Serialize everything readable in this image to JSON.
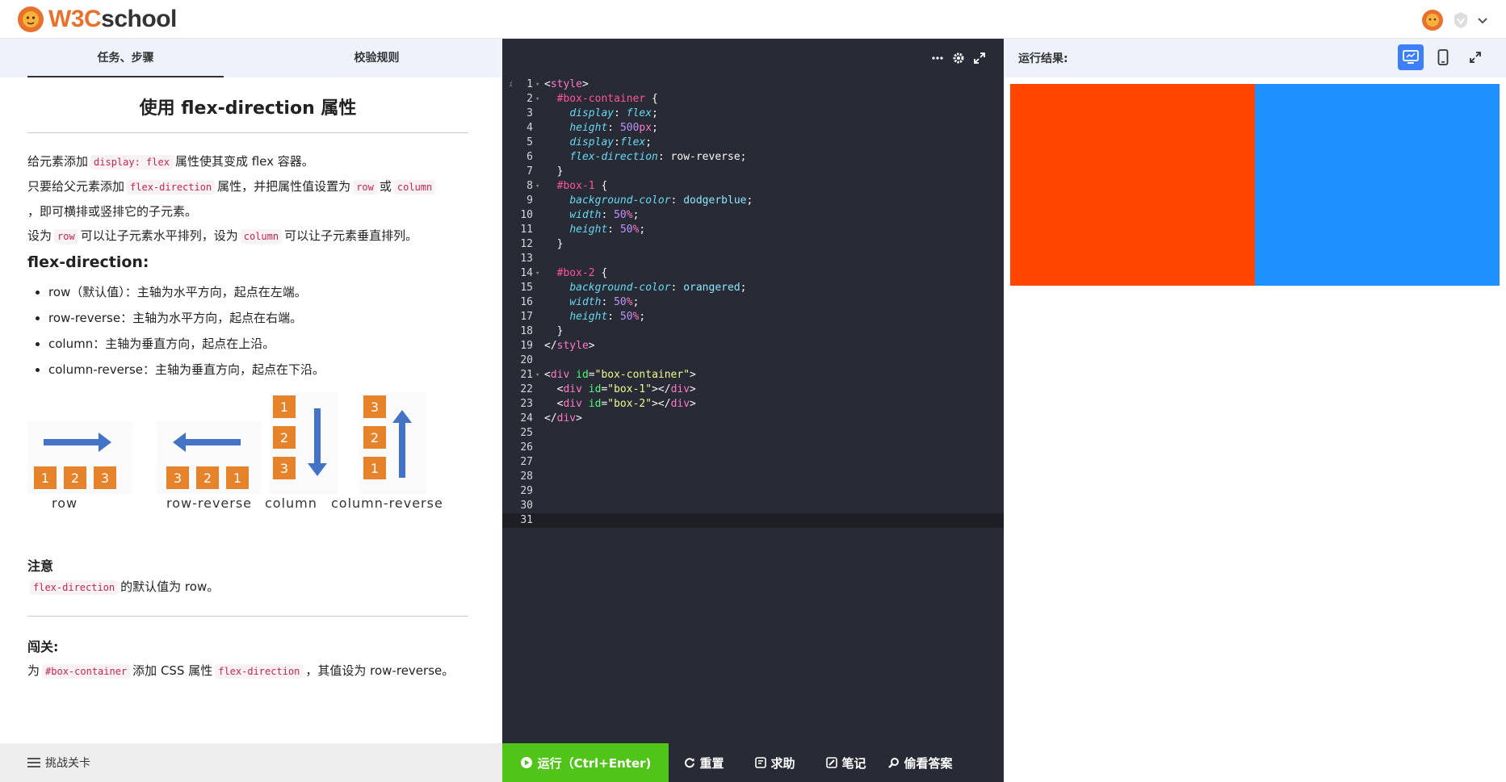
{
  "header": {
    "logo_w3": "W3C",
    "logo_school": "school"
  },
  "left": {
    "tabs": [
      {
        "label": "任务、步骤"
      },
      {
        "label": "校验规则"
      }
    ],
    "title": "使用 flex-direction 属性",
    "p1": {
      "a": "给元素添加",
      "code": "display: flex",
      "b": "属性使其变成 flex 容器。"
    },
    "p2": {
      "a": "只要给父元素添加",
      "code1": "flex-direction",
      "b": "属性，并把属性值设置为",
      "code2": "row",
      "c": "或",
      "code3": "column",
      "d": "，即可横排或竖排它的子元素。"
    },
    "p3": {
      "a": "设为",
      "code1": "row",
      "b": "可以让子元素水平排列，设为",
      "code2": "column",
      "c": "可以让子元素垂直排列。"
    },
    "subheading": "flex-direction:",
    "bullets": [
      "row（默认值）：主轴为水平方向，起点在左端。",
      "row-reverse：主轴为水平方向，起点在右端。",
      "column：主轴为垂直方向，起点在上沿。",
      "column-reverse：主轴为垂直方向，起点在下沿。"
    ],
    "diagram_labels": [
      "row",
      "row-reverse",
      "column",
      "column-reverse"
    ],
    "note_title": "注意",
    "note": {
      "code": "flex-direction",
      "text": "的默认值为 row。"
    },
    "challenge_title": "闯关:",
    "challenge": {
      "a": "为",
      "code1": "#box-container",
      "b": "添加 CSS 属性",
      "code2": "flex-direction",
      "c": "，其值设为 row-reverse。"
    },
    "footer_label": "挑战关卡"
  },
  "editor": {
    "line_numbers": [
      "1",
      "2",
      "3",
      "4",
      "5",
      "6",
      "7",
      "8",
      "9",
      "10",
      "11",
      "12",
      "13",
      "14",
      "15",
      "16",
      "17",
      "18",
      "19",
      "20",
      "21",
      "22",
      "23",
      "24",
      "25",
      "26",
      "27",
      "28",
      "29",
      "30",
      "31"
    ],
    "tokens": {
      "style_tag": "style",
      "sel_container": "#box-container",
      "sel_box1": "#box-1",
      "sel_box2": "#box-2",
      "p_display": "display",
      "p_height": "height",
      "p_flexdir": "flex-direction",
      "p_bg": "background-color",
      "p_width": "width",
      "v_flex": "flex",
      "v_500": "500",
      "v_px": "px",
      "v_rowrev": "row-reverse",
      "v_dodger": "dodgerblue",
      "v_orange": "orangered",
      "v_50": "50",
      "v_pct": "%",
      "div_tag": "div",
      "attr_id": "id",
      "s_container": "\"box-container\"",
      "s_box1": "\"box-1\"",
      "s_box2": "\"box-2\""
    },
    "buttons": {
      "run": "运行（Ctrl+Enter)",
      "reset": "重置",
      "help": "求助",
      "notes": "笔记",
      "answer": "偷看答案"
    }
  },
  "result": {
    "title": "运行结果:",
    "colors": {
      "box1": "#1e90ff",
      "box2": "#ff4500"
    }
  },
  "colors": {
    "brand_orange": "#e8722c",
    "run_green": "#51c41a",
    "editor_bg": "#282a36",
    "active_blue": "#3d7ef9"
  }
}
